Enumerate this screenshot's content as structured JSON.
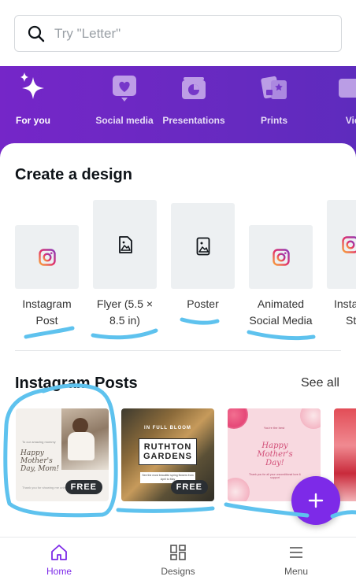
{
  "search": {
    "placeholder": "Try \"Letter\""
  },
  "categories": [
    {
      "label": "For you",
      "icon": "sparkle-icon"
    },
    {
      "label": "Social media",
      "icon": "heart-bubble-icon"
    },
    {
      "label": "Presentations",
      "icon": "presentation-chart-icon"
    },
    {
      "label": "Prints",
      "icon": "prints-icon"
    },
    {
      "label": "Vid",
      "icon": "video-icon"
    }
  ],
  "create": {
    "title": "Create a design",
    "items": [
      {
        "line1": "Instagram",
        "line2": "Post",
        "icon": "instagram-icon"
      },
      {
        "line1": "Flyer (5.5 ×",
        "line2": "8.5 in)",
        "icon": "flyer-icon"
      },
      {
        "line1": "Poster",
        "line2": "",
        "icon": "poster-icon"
      },
      {
        "line1": "Animated",
        "line2": "Social Media",
        "icon": "instagram-icon"
      },
      {
        "line1": "Insta",
        "line2": "St",
        "icon": "instagram-icon"
      }
    ]
  },
  "instagram": {
    "title": "Instagram Posts",
    "see_all": "See all",
    "posts": [
      {
        "script_text": "Happy Mother's Day, Mom!",
        "small_caption": "To our amazing mommy",
        "footer_caption": "Thank you for showing me unity, kindness",
        "badge": "FREE"
      },
      {
        "top": "IN FULL BLOOM",
        "name_line1": "RUTHTON",
        "name_line2": "GARDENS",
        "sub": "See the most beautiful spring flowers from April to May",
        "badge": "FREE"
      },
      {
        "small_top": "You're the best",
        "script_text": "Happy Mother's Day!",
        "sub": "Thank you for all your unconditional love & support"
      }
    ]
  },
  "colors": {
    "accent": "#7d2ae8",
    "band": "#6a29c2",
    "scribble": "#5ec2ee"
  },
  "nav": [
    {
      "label": "Home",
      "icon": "home-icon",
      "active": true
    },
    {
      "label": "Designs",
      "icon": "designs-grid-icon",
      "active": false
    },
    {
      "label": "Menu",
      "icon": "menu-icon",
      "active": false
    }
  ]
}
